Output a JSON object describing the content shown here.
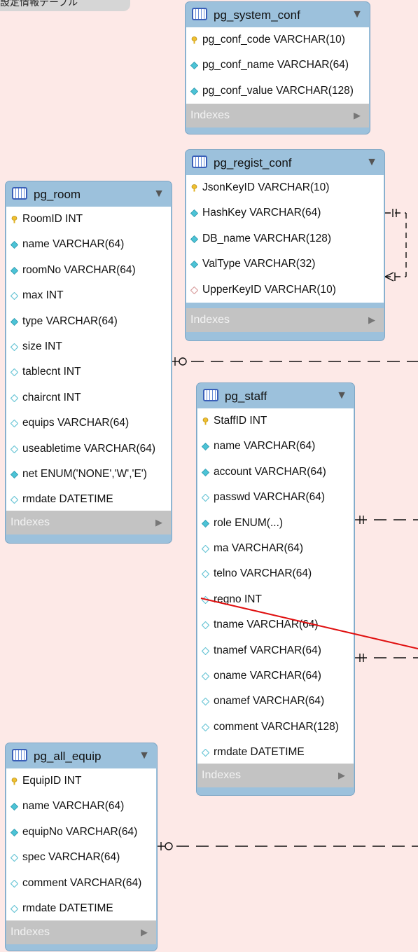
{
  "group_label": "設定情報テーブル",
  "tables": {
    "pg_system_conf": {
      "name": "pg_system_conf",
      "indexes_label": "Indexes",
      "columns": [
        "pg_conf_code VARCHAR(10)",
        "pg_conf_name VARCHAR(64)",
        "pg_conf_value VARCHAR(128)"
      ]
    },
    "pg_regist_conf": {
      "name": "pg_regist_conf",
      "indexes_label": "Indexes",
      "columns": [
        "JsonKeyID VARCHAR(10)",
        "HashKey VARCHAR(64)",
        "DB_name VARCHAR(128)",
        "ValType VARCHAR(32)",
        "UpperKeyID VARCHAR(10)"
      ]
    },
    "pg_room": {
      "name": "pg_room",
      "indexes_label": "Indexes",
      "columns": [
        "RoomID INT",
        "name VARCHAR(64)",
        "roomNo VARCHAR(64)",
        "max INT",
        "type VARCHAR(64)",
        "size INT",
        "tablecnt INT",
        "chaircnt INT",
        "equips VARCHAR(64)",
        "useabletime VARCHAR(64)",
        "net ENUM('NONE','W','E')",
        "rmdate DATETIME"
      ]
    },
    "pg_staff": {
      "name": "pg_staff",
      "indexes_label": "Indexes",
      "columns": [
        "StaffID INT",
        "name VARCHAR(64)",
        "account VARCHAR(64)",
        "passwd VARCHAR(64)",
        "role ENUM(...)",
        "ma VARCHAR(64)",
        "telno VARCHAR(64)",
        "regno INT",
        "tname VARCHAR(64)",
        "tnamef VARCHAR(64)",
        "oname VARCHAR(64)",
        "onamef VARCHAR(64)",
        "comment VARCHAR(128)",
        "rmdate DATETIME"
      ]
    },
    "pg_all_equip": {
      "name": "pg_all_equip",
      "indexes_label": "Indexes",
      "columns": [
        "EquipID INT",
        "name VARCHAR(64)",
        "equipNo VARCHAR(64)",
        "spec VARCHAR(64)",
        "comment VARCHAR(64)",
        "rmdate DATETIME"
      ]
    }
  },
  "colors": {
    "canvas": "#fde9e7",
    "table_header": "#9cc1dc",
    "indexes_bar": "#c3c3c3",
    "primary_key": "#f0c030",
    "column_filled": "#4cc3d6",
    "foreign_key": "#d9a0a0",
    "selected_relation": "#e01010"
  }
}
